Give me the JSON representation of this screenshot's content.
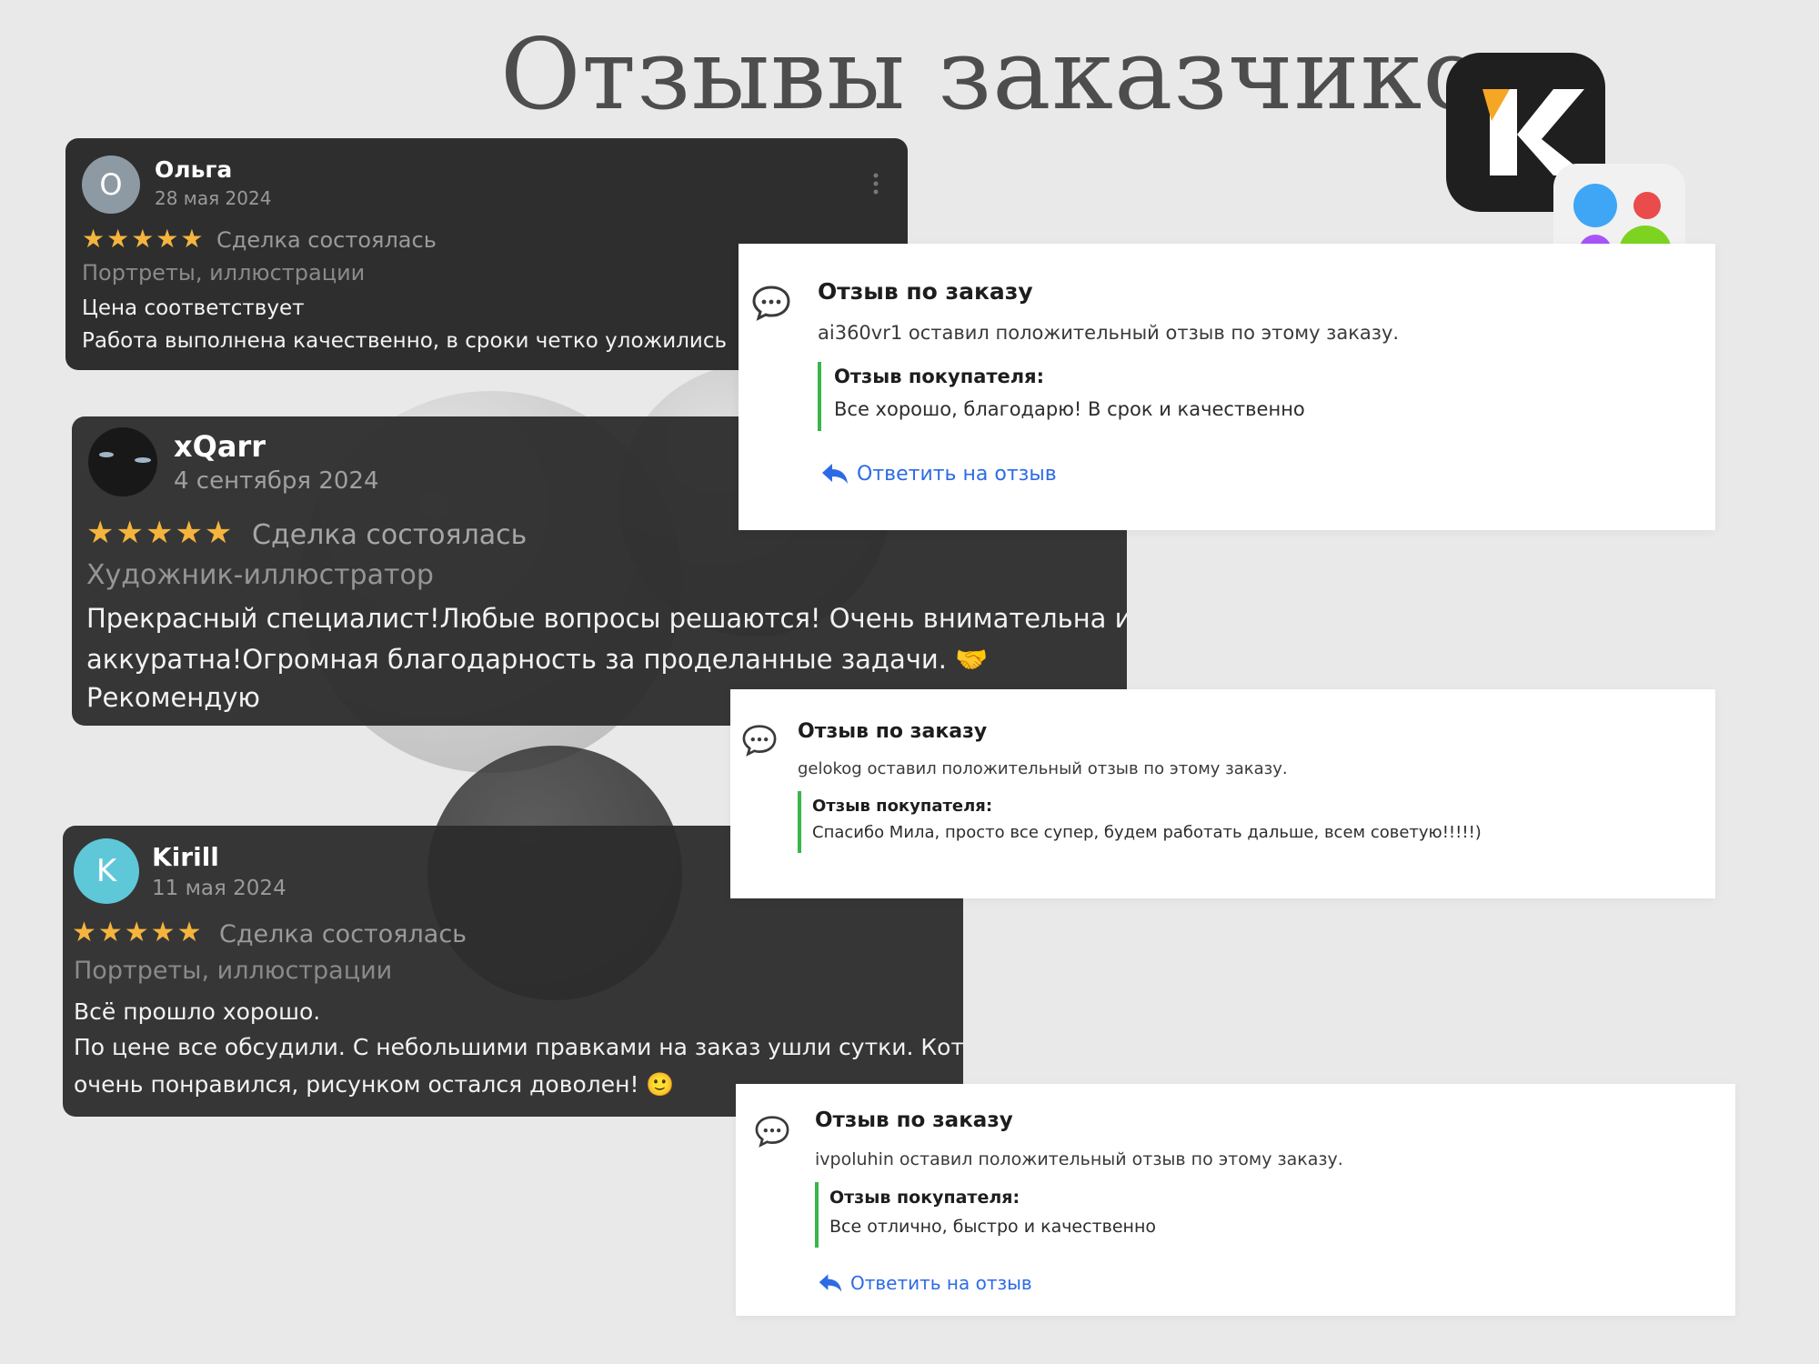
{
  "page": {
    "title": "Отзывы заказчиков"
  },
  "brand": {
    "k_logo_letter": "K",
    "k_logo_accent": "#f5a623",
    "dots_colors": [
      "#3ea6f5",
      "#ea4b4b",
      "#a855f7",
      "#7ed321"
    ]
  },
  "reviews": [
    {
      "avatar_letter": "О",
      "avatar_color": "#8e9aa3",
      "name": "Ольга",
      "date": "28 мая 2024",
      "stars": "★★★★★",
      "deal": "Сделка состоялась",
      "category": "Портреты, иллюстрации",
      "lines": [
        "Цена соответствует",
        "Работа выполнена качественно, в сроки четко уложились"
      ]
    },
    {
      "avatar_letter": "",
      "avatar_color": "#1b1b1b",
      "name": "xQarr",
      "date": "4 сентября 2024",
      "stars": "★★★★★",
      "deal": "Сделка состоялась",
      "category": "Художник-иллюстратор",
      "lines": [
        "Прекрасный специалист!Любые вопросы решаются! Очень внимательна и",
        "аккуратна!Огромная благодарность за проделанные задачи. 🤝",
        "Рекомендую"
      ]
    },
    {
      "avatar_letter": "K",
      "avatar_color": "#5fc8d8",
      "name": "Kirill",
      "date": "11 мая 2024",
      "stars": "★★★★★",
      "deal": "Сделка состоялась",
      "category": "Портреты, иллюстрации",
      "lines": [
        "Всё прошло хорошо.",
        "По цене все обсудили. С небольшими правками на заказ ушли сутки. Котик",
        "очень понравился, рисунком остался доволен! 🙂"
      ]
    }
  ],
  "notices": [
    {
      "title": "Отзыв по заказу",
      "desc": "ai360vr1 оставил положительный отзыв по этому заказу.",
      "quote_label": "Отзыв покупателя:",
      "quote_text": "Все хорошо, благодарю! В срок и качественно",
      "reply": "Ответить на отзыв"
    },
    {
      "title": "Отзыв по заказу",
      "desc": "gelokog оставил положительный отзыв по этому заказу.",
      "quote_label": "Отзыв покупателя:",
      "quote_text": "Спасибо Мила, просто все супер, будем работать дальше, всем советую!!!!!)"
    },
    {
      "title": "Отзыв по заказу",
      "desc": "ivpoluhin оставил положительный отзыв по этому заказу.",
      "quote_label": "Отзыв покупателя:",
      "quote_text": "Все отлично, быстро и качественно",
      "reply": "Ответить на отзыв"
    }
  ]
}
